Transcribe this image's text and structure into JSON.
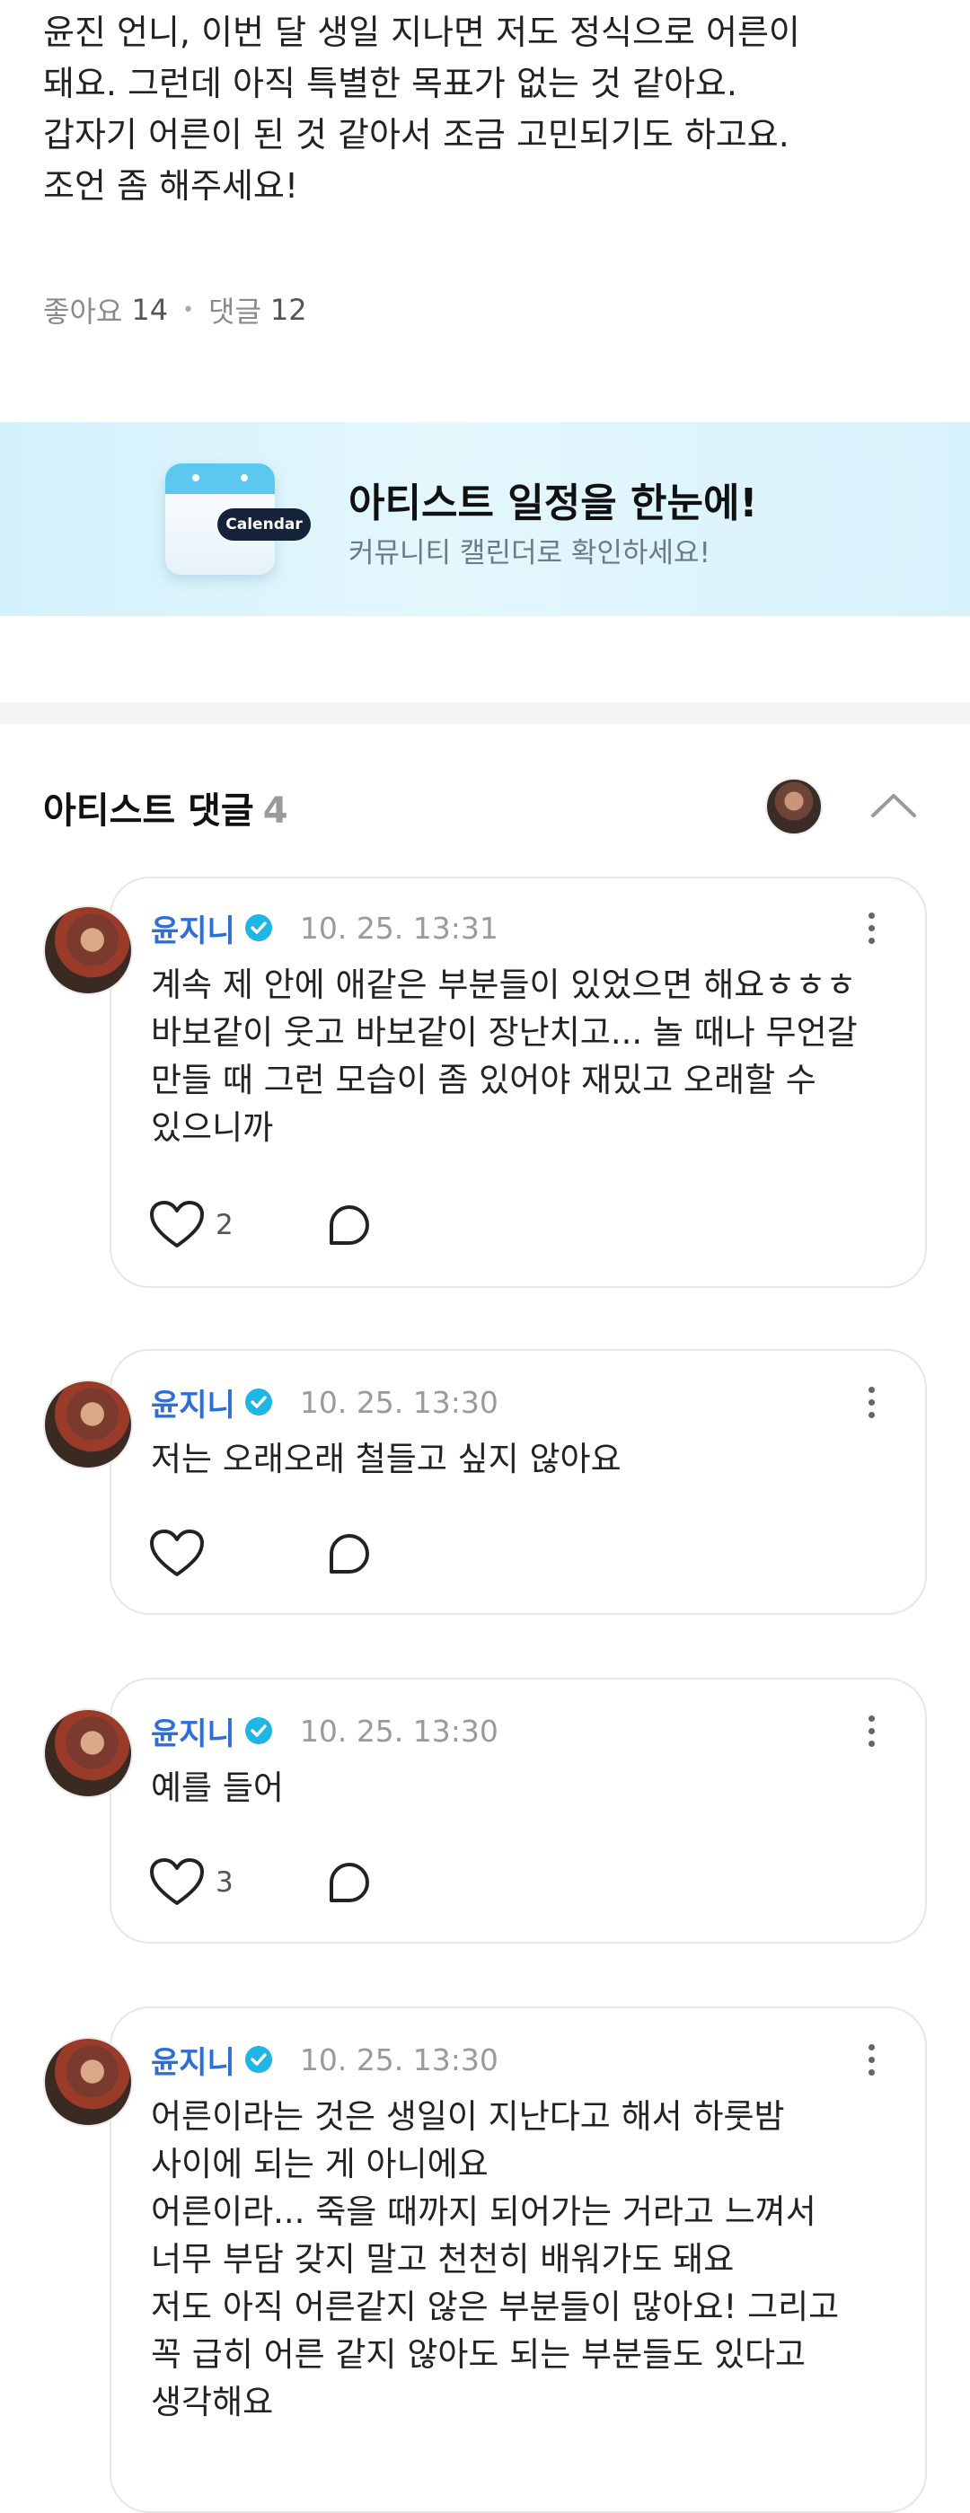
{
  "post": {
    "lines": [
      "윤진 언니, 이번 달 생일 지나면 저도 정식으로 어른이",
      "돼요. 그런데 아직 특별한 목표가 없는 것 같아요.",
      "갑자기 어른이 된 것 같아서 조금 고민되기도 하고요.",
      "조언 좀 해주세요!"
    ],
    "likes_label": "좋아요",
    "likes_count": "14",
    "comments_label": "댓글",
    "comments_count": "12"
  },
  "banner": {
    "calendar_label": "Calendar",
    "title": "아티스트 일정을 한눈에!",
    "subtitle": "커뮤니티 캘린더로 확인하세요!",
    "accent": "#5cc8f0"
  },
  "artist_comments": {
    "title": "아티스트 댓글",
    "count": "4",
    "collapse_icon": "chevron-up-icon",
    "items": [
      {
        "author": "윤지니",
        "time": "10. 25. 13:31",
        "lines": [
          "계속 제 안에 애같은 부분들이 있었으면 해요ㅎㅎㅎ",
          "바보같이 웃고 바보같이 장난치고... 놀 때나 무언갈",
          "만들 때 그런 모습이 좀 있어야 재밌고 오래할 수",
          "있으니까"
        ],
        "likes": "2"
      },
      {
        "author": "윤지니",
        "time": "10. 25. 13:30",
        "lines": [
          "저는 오래오래 철들고 싶지 않아요"
        ],
        "likes": ""
      },
      {
        "author": "윤지니",
        "time": "10. 25. 13:30",
        "lines": [
          "예를 들어"
        ],
        "likes": "3"
      },
      {
        "author": "윤지니",
        "time": "10. 25. 13:30",
        "lines": [
          "어른이라는 것은 생일이 지난다고 해서 하룻밤",
          "사이에 되는 게 아니에요",
          "어른이라... 죽을 때까지 되어가는 거라고 느껴서",
          "너무 부담 갖지 말고 천천히 배워가도 돼요",
          "저도 아직 어른같지 않은 부분들이 많아요! 그리고",
          "꼭 급히 어른 같지 않아도 되는 부분들도 있다고",
          "생각해요"
        ],
        "likes": ""
      }
    ]
  },
  "colors": {
    "name": "#2d6fd6",
    "verified": "#1fb6e6",
    "divider": "#f2f3f5"
  }
}
